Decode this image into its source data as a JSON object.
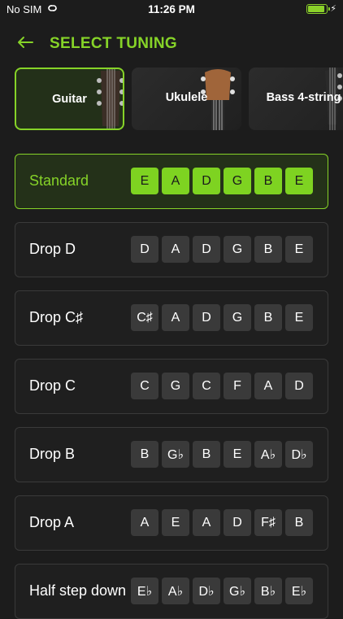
{
  "status_bar": {
    "carrier": "No SIM",
    "time": "11:26 PM",
    "battery_level": 0.9
  },
  "header": {
    "title": "SELECT TUNING"
  },
  "instruments": [
    {
      "label": "Guitar",
      "selected": true
    },
    {
      "label": "Ukulele",
      "selected": false
    },
    {
      "label": "Bass 4-string",
      "selected": false
    }
  ],
  "tunings": [
    {
      "name": "Standard",
      "notes": [
        "E",
        "A",
        "D",
        "G",
        "B",
        "E"
      ],
      "selected": true
    },
    {
      "name": "Drop D",
      "notes": [
        "D",
        "A",
        "D",
        "G",
        "B",
        "E"
      ],
      "selected": false
    },
    {
      "name": "Drop C♯",
      "notes": [
        "C♯",
        "A",
        "D",
        "G",
        "B",
        "E"
      ],
      "selected": false
    },
    {
      "name": "Drop C",
      "notes": [
        "C",
        "G",
        "C",
        "F",
        "A",
        "D"
      ],
      "selected": false
    },
    {
      "name": "Drop B",
      "notes": [
        "B",
        "G♭",
        "B",
        "E",
        "A♭",
        "D♭"
      ],
      "selected": false
    },
    {
      "name": "Drop A",
      "notes": [
        "A",
        "E",
        "A",
        "D",
        "F♯",
        "B"
      ],
      "selected": false
    },
    {
      "name": "Half step down",
      "notes": [
        "E♭",
        "A♭",
        "D♭",
        "G♭",
        "B♭",
        "E♭"
      ],
      "selected": false
    }
  ],
  "colors": {
    "accent": "#86d328",
    "background": "#1c1c1c",
    "chip": "#3a3a3a"
  }
}
